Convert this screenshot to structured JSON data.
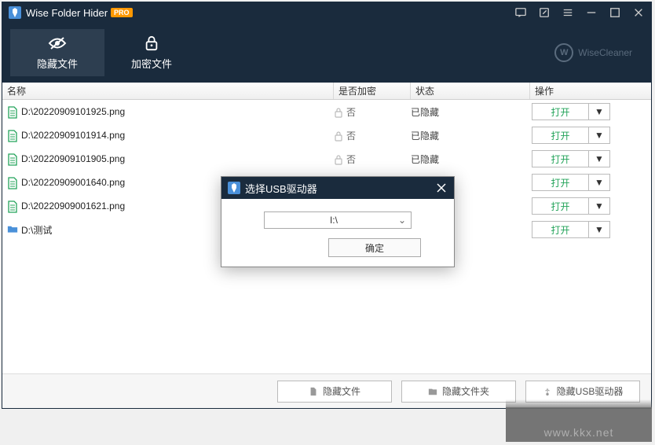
{
  "title": "Wise Folder Hider",
  "pro": "PRO",
  "tabs": {
    "hide": "隐藏文件",
    "encrypt": "加密文件"
  },
  "brand": "WiseCleaner",
  "headers": {
    "name": "名称",
    "enc": "是否加密",
    "status": "状态",
    "action": "操作"
  },
  "enc_no": "否",
  "status_hidden": "已隐藏",
  "open_label": "打开",
  "rows": [
    {
      "name": "D:\\20220909101925.png",
      "type": "doc",
      "enc": true,
      "status": true
    },
    {
      "name": "D:\\20220909101914.png",
      "type": "doc",
      "enc": true,
      "status": true
    },
    {
      "name": "D:\\20220909101905.png",
      "type": "doc",
      "enc": true,
      "status": true
    },
    {
      "name": "D:\\20220909001640.png",
      "type": "doc",
      "enc": false,
      "status": false
    },
    {
      "name": "D:\\20220909001621.png",
      "type": "doc",
      "enc": false,
      "status": false
    },
    {
      "name": "D:\\测试",
      "type": "fld",
      "enc": false,
      "status": false
    }
  ],
  "footer": {
    "hide_file": "隐藏文件",
    "hide_folder": "隐藏文件夹",
    "hide_usb": "隐藏USB驱动器"
  },
  "dialog": {
    "title": "选择USB驱动器",
    "drive": "I:\\",
    "ok": "确定"
  },
  "watermark": "www.kkx.net"
}
